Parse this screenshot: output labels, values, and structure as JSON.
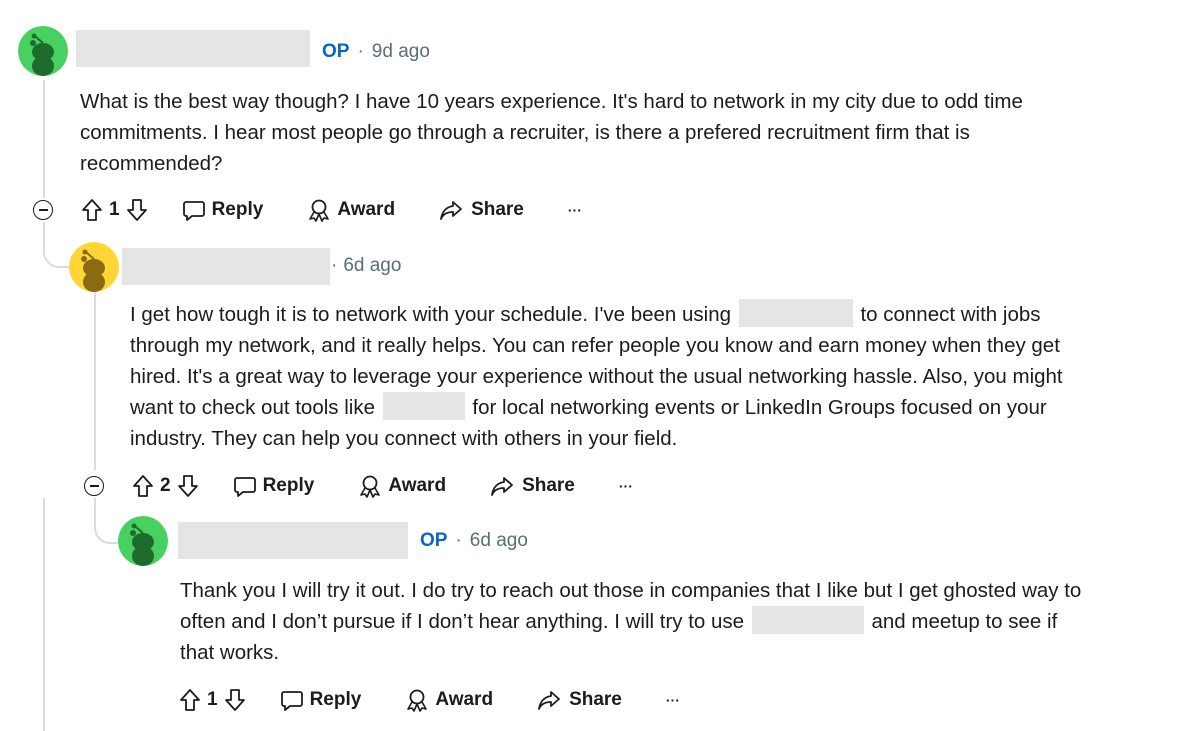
{
  "colors": {
    "op_accent": "#0a66c2",
    "meta_gray": "#576f76",
    "text": "#1c1c1c",
    "redaction": "#e5e5e5",
    "avatar_green": "#46d160",
    "avatar_yellow": "#ffd635"
  },
  "comments": [
    {
      "is_op": true,
      "op_label": "OP",
      "separator": "·",
      "age": "9d ago",
      "avatar": "snoo-green-avatar",
      "lines": [
        "What is the best way though? I have 10 years experience. It's hard to network in my city due to odd time",
        "commitments. I hear most people go through a recruiter, is there a prefered recruitment firm that is",
        "recommended?"
      ],
      "votes": "1",
      "actions": {
        "reply": "Reply",
        "award": "Award",
        "share": "Share",
        "more": "···"
      }
    },
    {
      "is_op": false,
      "separator": "·",
      "age": "6d ago",
      "avatar": "snoo-yellow-avatar",
      "lines": [
        "I get how tough it is to network with your schedule. I've been using",
        "to connect with jobs",
        "through my network, and it really helps. You can refer people you know and earn money when they get",
        "hired. It's a great way to leverage your experience without the usual networking hassle. Also, you might",
        "want to check out tools like",
        "for local networking events or LinkedIn Groups focused on your",
        "industry. They can help you connect with others in your field."
      ],
      "votes": "2",
      "actions": {
        "reply": "Reply",
        "award": "Award",
        "share": "Share",
        "more": "···"
      }
    },
    {
      "is_op": true,
      "op_label": "OP",
      "separator": "·",
      "age": "6d ago",
      "avatar": "snoo-green-avatar",
      "lines": [
        "Thank you I will try it out. I do try to reach out those in companies that I like but I get ghosted way to",
        "often and I don’t pursue if I don’t hear anything. I will try to use",
        "and meetup to see if",
        "that works."
      ],
      "votes": "1",
      "actions": {
        "reply": "Reply",
        "award": "Award",
        "share": "Share",
        "more": "···"
      }
    }
  ]
}
